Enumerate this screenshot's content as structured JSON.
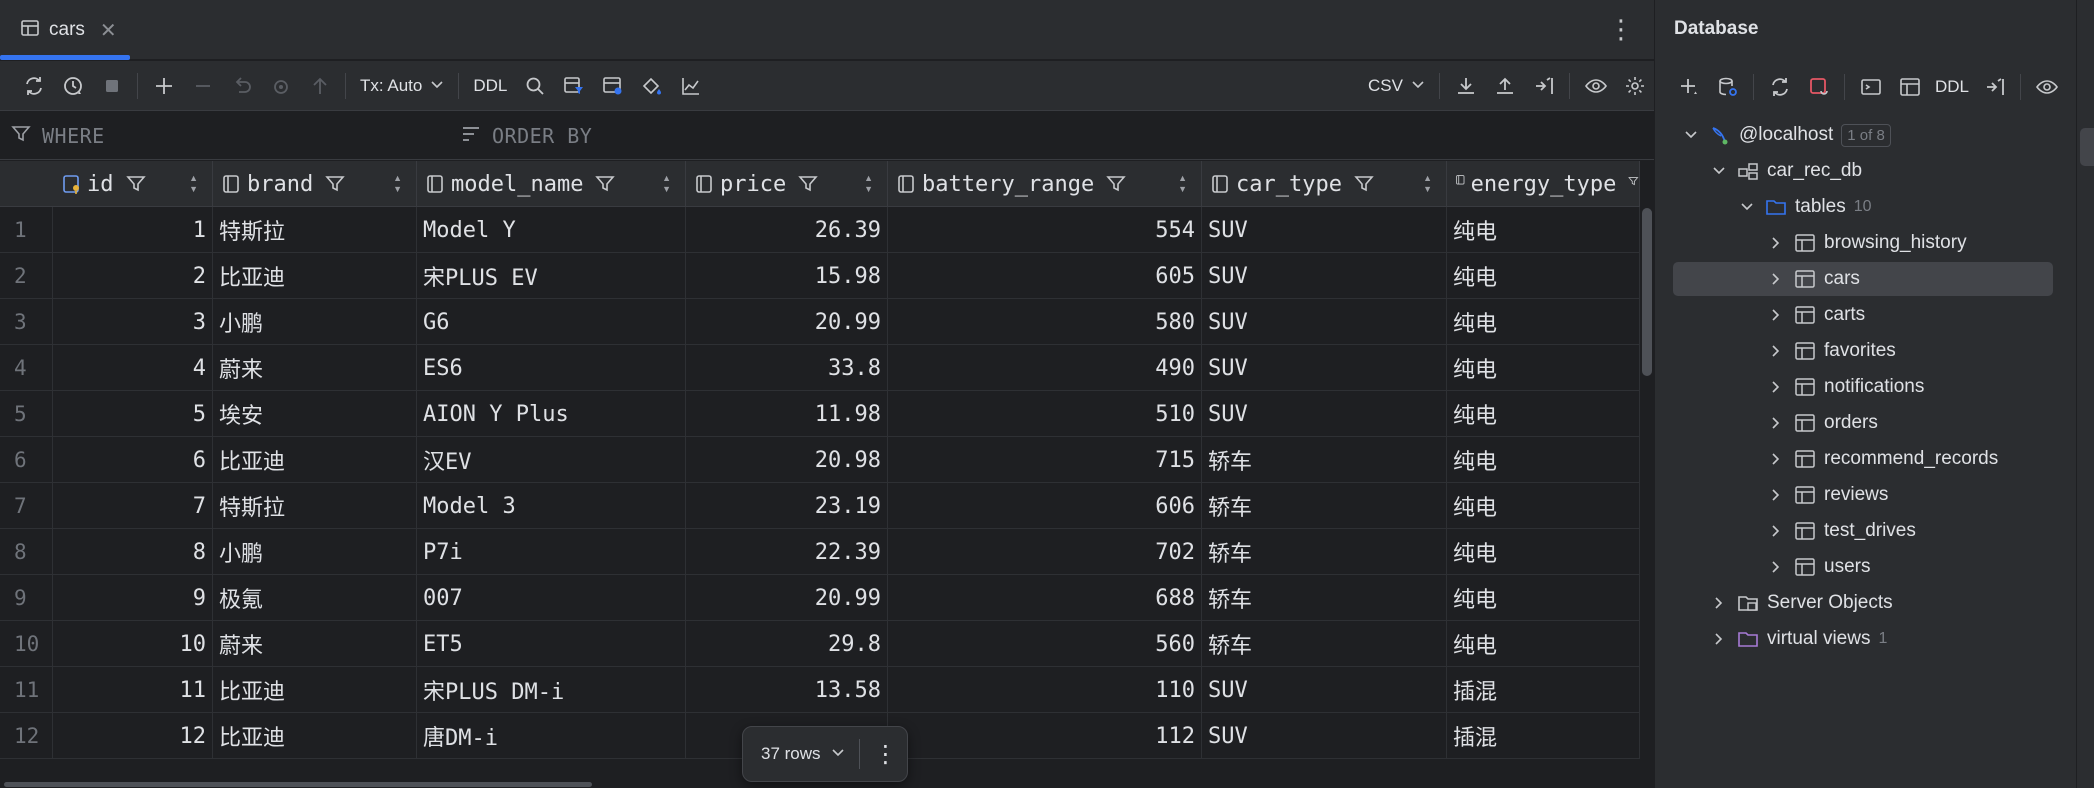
{
  "editor": {
    "tab": {
      "label": "cars"
    },
    "toolbar": {
      "tx_mode": "Tx: Auto",
      "ddl": "DDL",
      "export_format": "CSV"
    },
    "filter": {
      "where_label": "WHERE",
      "orderby_label": "ORDER BY"
    },
    "grid": {
      "columns": [
        "id",
        "brand",
        "model_name",
        "price",
        "battery_range",
        "car_type",
        "energy_type"
      ],
      "rows": [
        {
          "n": "1",
          "id": "1",
          "brand": "特斯拉",
          "model_name": "Model Y",
          "price": "26.39",
          "battery_range": "554",
          "car_type": "SUV",
          "energy_type": "纯电"
        },
        {
          "n": "2",
          "id": "2",
          "brand": "比亚迪",
          "model_name": "宋PLUS EV",
          "price": "15.98",
          "battery_range": "605",
          "car_type": "SUV",
          "energy_type": "纯电"
        },
        {
          "n": "3",
          "id": "3",
          "brand": "小鹏",
          "model_name": "G6",
          "price": "20.99",
          "battery_range": "580",
          "car_type": "SUV",
          "energy_type": "纯电"
        },
        {
          "n": "4",
          "id": "4",
          "brand": "蔚来",
          "model_name": "ES6",
          "price": "33.8",
          "battery_range": "490",
          "car_type": "SUV",
          "energy_type": "纯电"
        },
        {
          "n": "5",
          "id": "5",
          "brand": "埃安",
          "model_name": "AION Y Plus",
          "price": "11.98",
          "battery_range": "510",
          "car_type": "SUV",
          "energy_type": "纯电"
        },
        {
          "n": "6",
          "id": "6",
          "brand": "比亚迪",
          "model_name": "汉EV",
          "price": "20.98",
          "battery_range": "715",
          "car_type": "轿车",
          "energy_type": "纯电"
        },
        {
          "n": "7",
          "id": "7",
          "brand": "特斯拉",
          "model_name": "Model 3",
          "price": "23.19",
          "battery_range": "606",
          "car_type": "轿车",
          "energy_type": "纯电"
        },
        {
          "n": "8",
          "id": "8",
          "brand": "小鹏",
          "model_name": "P7i",
          "price": "22.39",
          "battery_range": "702",
          "car_type": "轿车",
          "energy_type": "纯电"
        },
        {
          "n": "9",
          "id": "9",
          "brand": "极氪",
          "model_name": "007",
          "price": "20.99",
          "battery_range": "688",
          "car_type": "轿车",
          "energy_type": "纯电"
        },
        {
          "n": "10",
          "id": "10",
          "brand": "蔚来",
          "model_name": "ET5",
          "price": "29.8",
          "battery_range": "560",
          "car_type": "轿车",
          "energy_type": "纯电"
        },
        {
          "n": "11",
          "id": "11",
          "brand": "比亚迪",
          "model_name": "宋PLUS DM-i",
          "price": "13.58",
          "battery_range": "110",
          "car_type": "SUV",
          "energy_type": "插混"
        },
        {
          "n": "12",
          "id": "12",
          "brand": "比亚迪",
          "model_name": "唐DM-i",
          "price": "",
          "battery_range": "112",
          "car_type": "SUV",
          "energy_type": "插混"
        }
      ]
    },
    "rows_pill": {
      "label": "37 rows"
    }
  },
  "database": {
    "title": "Database",
    "toolbar": {
      "ddl": "DDL"
    },
    "tree": {
      "host": {
        "label": "@localhost",
        "badge": "1 of 8"
      },
      "schema": {
        "label": "car_rec_db"
      },
      "tables_folder": {
        "label": "tables",
        "count": "10"
      },
      "tables": [
        "browsing_history",
        "cars",
        "carts",
        "favorites",
        "notifications",
        "orders",
        "recommend_records",
        "reviews",
        "test_drives",
        "users"
      ],
      "selected_table": "cars",
      "server_objects": {
        "label": "Server Objects"
      },
      "virtual_views": {
        "label": "virtual views",
        "count": "1"
      }
    }
  },
  "colors": {
    "background": "#1e1f22",
    "panel": "#2b2d30",
    "accent": "#3574f0",
    "text": "#dfe1e5",
    "muted": "#7a7e85",
    "selection": "#43454a"
  }
}
